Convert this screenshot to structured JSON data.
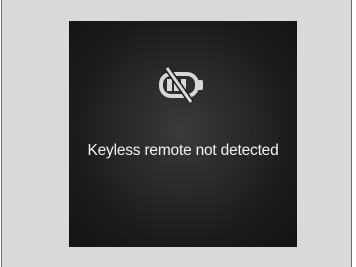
{
  "display": {
    "icon": "keyless-remote-battery-slash-icon",
    "message": "Keyless remote not detected"
  },
  "colors": {
    "frame_background": "#d9d9d9",
    "screen_background": "#1a1a1a",
    "text": "#f2f2f2",
    "icon": "#d8d8d8"
  }
}
